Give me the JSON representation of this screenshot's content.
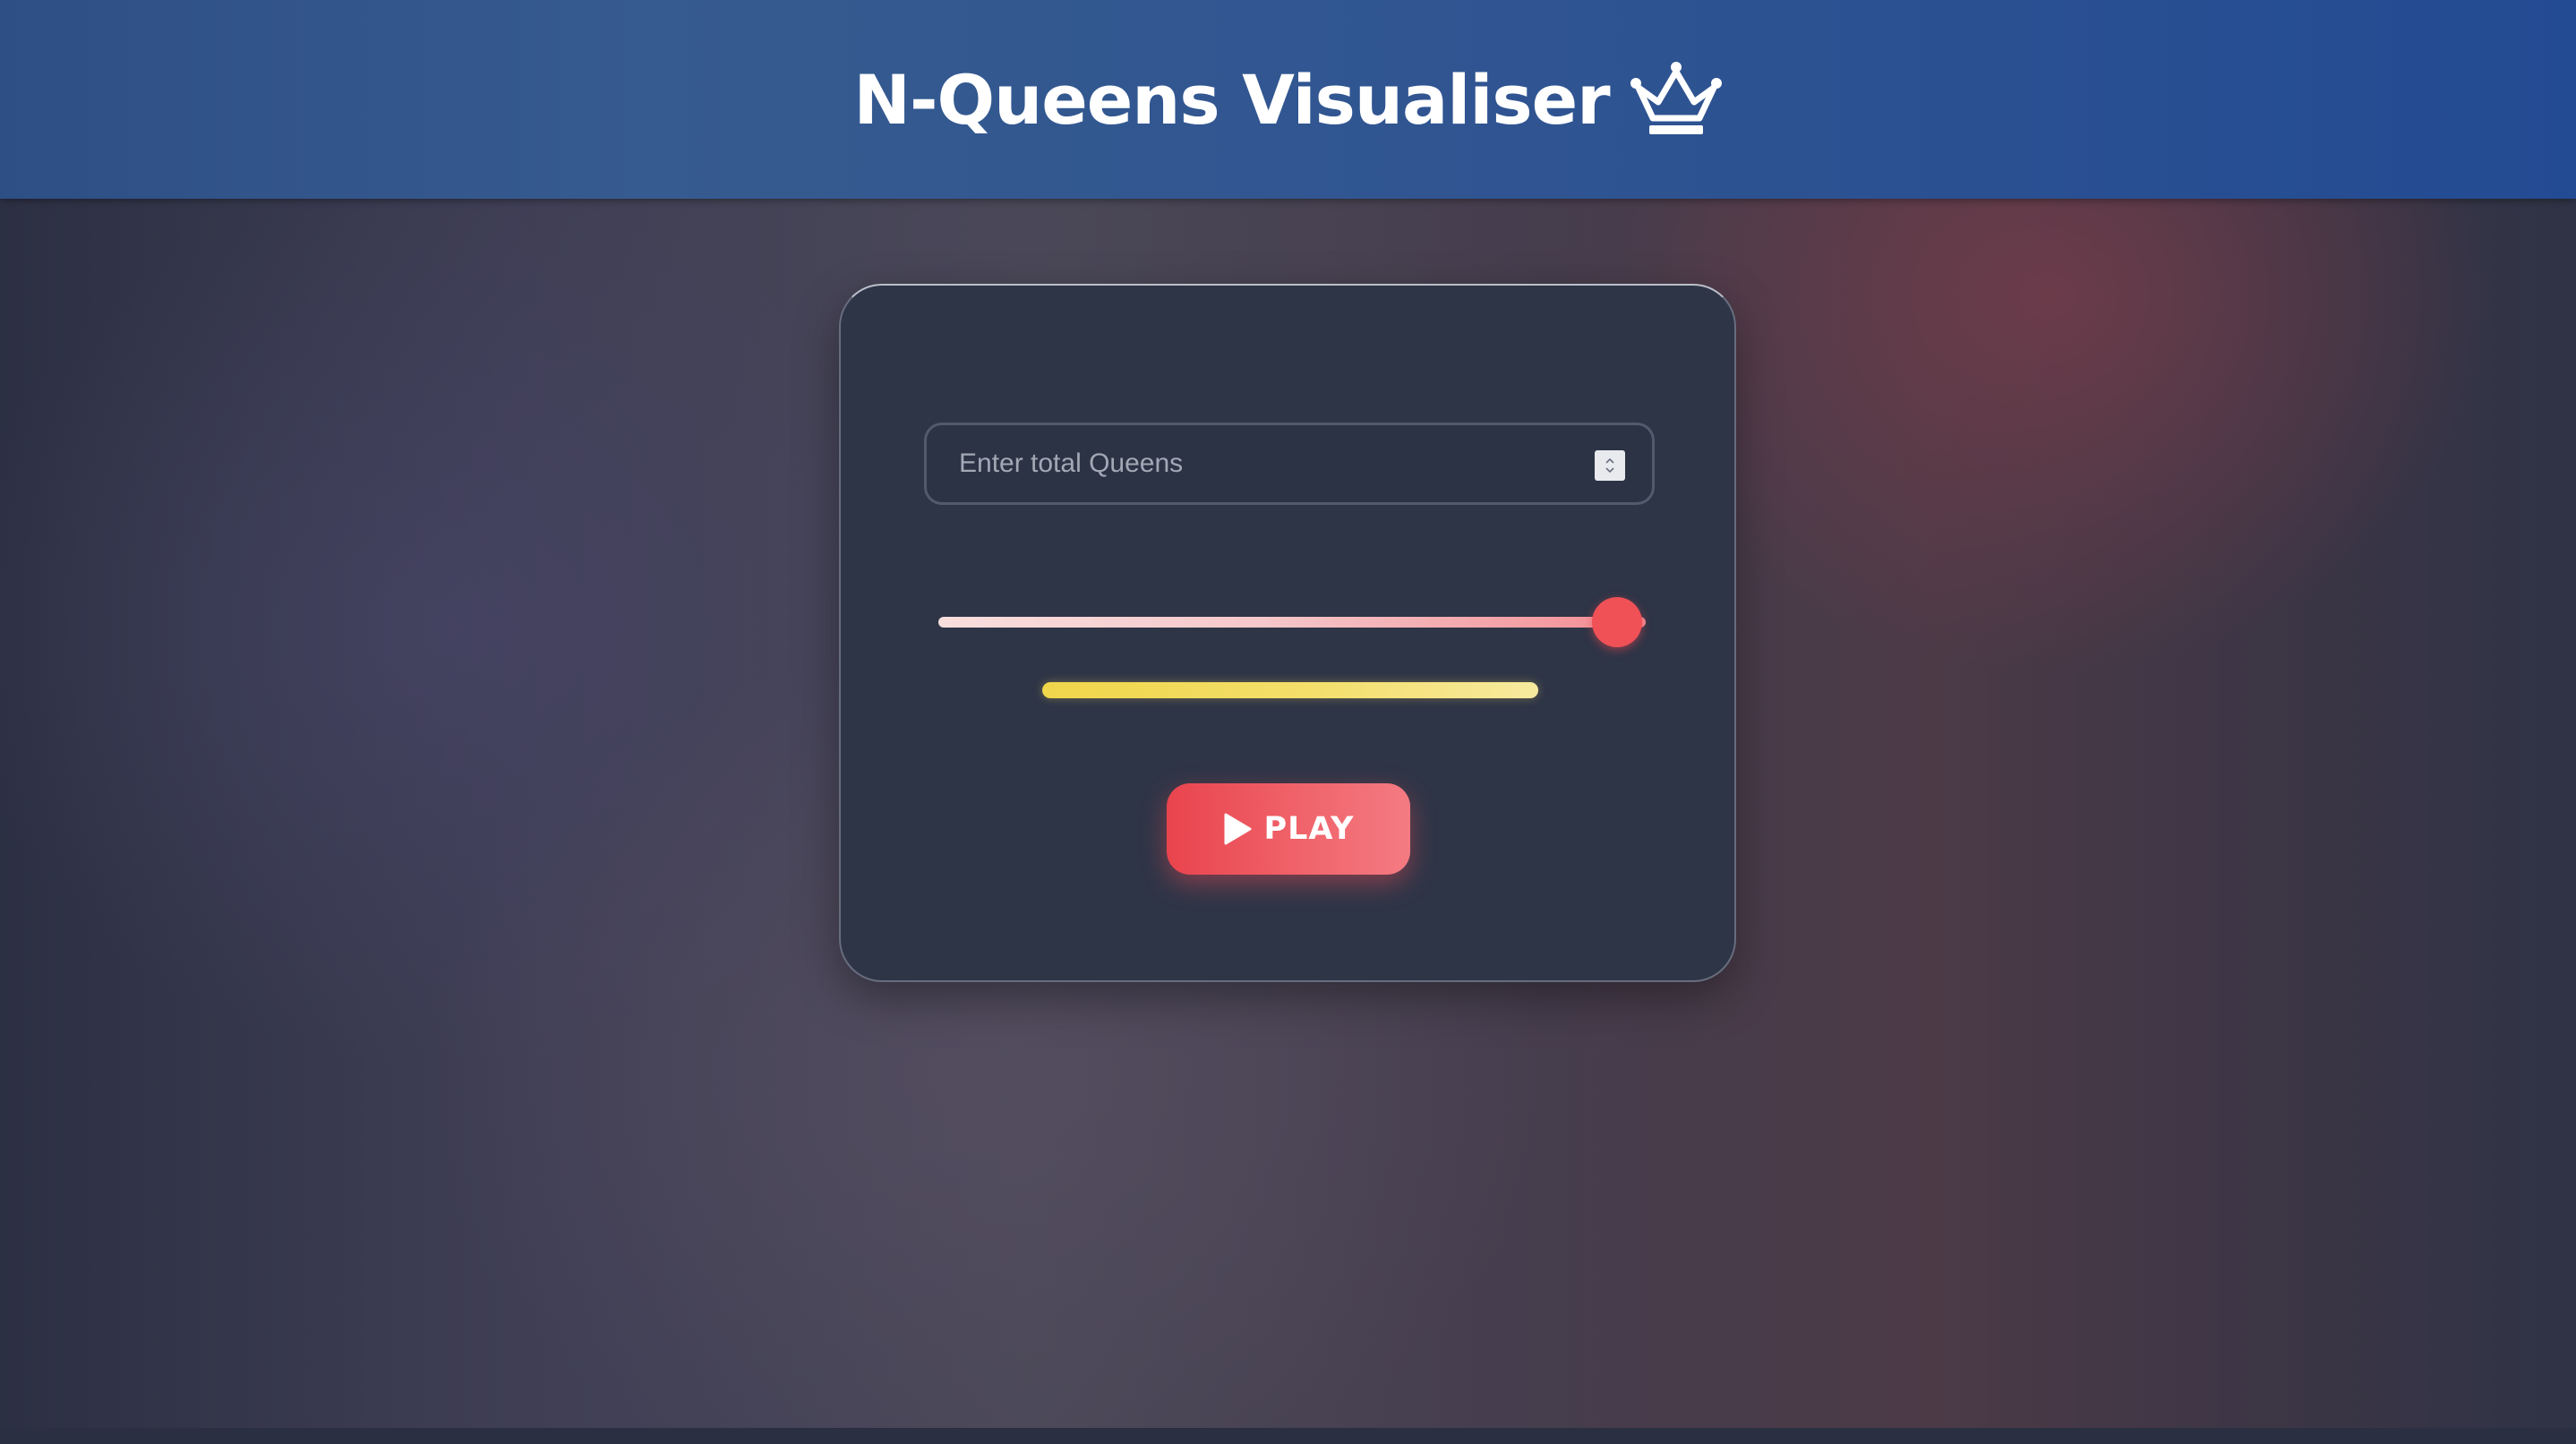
{
  "header": {
    "title": "N-Queens Visualiser",
    "title_icon": "crown-icon"
  },
  "controls": {
    "queens_input": {
      "placeholder": "Enter total Queens",
      "value": ""
    },
    "speed_slider": {
      "value_fraction": 0.96
    },
    "progress": {
      "value_fraction": 1.0
    },
    "play_button": {
      "label": "PLAY",
      "icon": "play-icon"
    }
  },
  "colors": {
    "header_blue": "#2f5491",
    "card_bg": "#2e3547",
    "accent_red": "#ef5156",
    "progress_yellow": "#f0d64a"
  }
}
